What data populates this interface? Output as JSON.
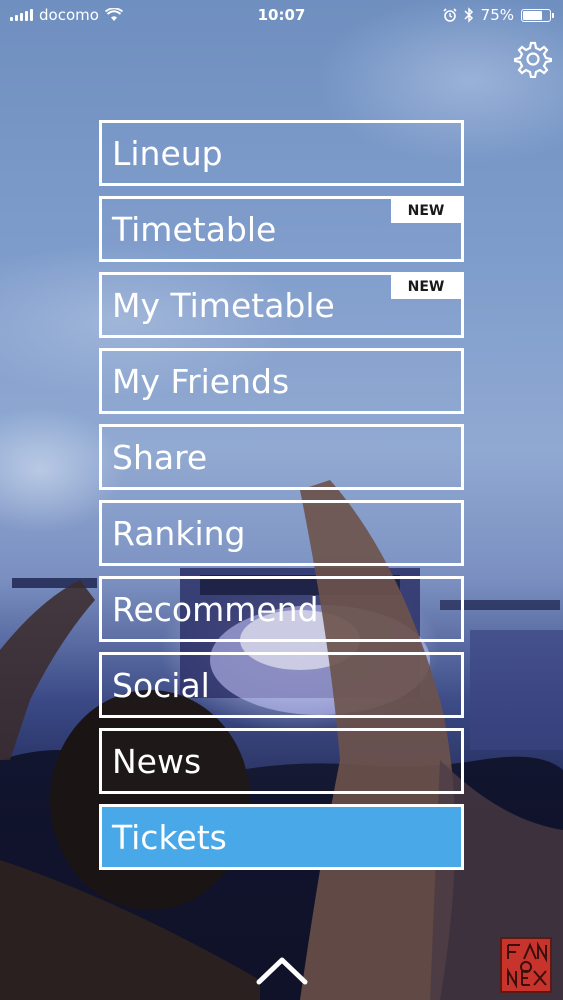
{
  "status_bar": {
    "carrier": "docomo",
    "time": "10:07",
    "battery_percent": "75%",
    "battery_level": 0.75
  },
  "settings": {
    "icon": "gear-icon"
  },
  "menu": {
    "items": [
      {
        "label": "Lineup",
        "badge": ""
      },
      {
        "label": "Timetable",
        "badge": "NEW"
      },
      {
        "label": "My Timetable",
        "badge": "NEW"
      },
      {
        "label": "My Friends",
        "badge": ""
      },
      {
        "label": "Share",
        "badge": ""
      },
      {
        "label": "Ranking",
        "badge": ""
      },
      {
        "label": "Recommend",
        "badge": ""
      },
      {
        "label": "Social",
        "badge": ""
      },
      {
        "label": "News",
        "badge": ""
      },
      {
        "label": "Tickets",
        "badge": ""
      }
    ],
    "highlight_color": "#49a8e8"
  },
  "footer": {
    "collapse_icon": "chevron-up-icon",
    "logo": "app-logo"
  }
}
